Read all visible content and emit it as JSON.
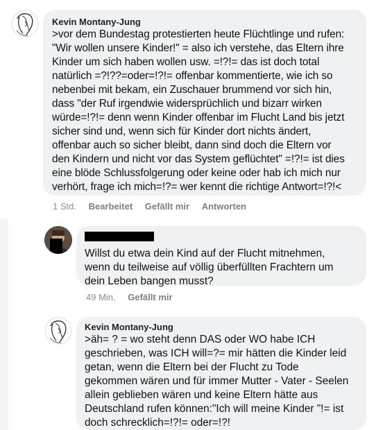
{
  "comments": [
    {
      "author": "Kevin Montany-Jung",
      "text": ">vor dem Bundestag protestierten heute Flüchtlinge und rufen:\n\"Wir wollen unsere Kinder!\" =  also ich verstehe, das Eltern ihre\nKinder um sich haben wollen usw. =!?!= das ist doch total\nnatürlich =?!??=oder=!?!= offenbar kommentierte, wie ich so\nnebenbei mit bekam,  ein Zuschauer  brummend vor sich hin,\ndass \"der Ruf irgendwie widersprüchlich und bizarr wirken\nwürde=!?!= denn wenn Kinder offenbar im Flucht Land bis jetzt\nsicher sind und, wenn  sich für Kinder dort nichts ändert,\noffenbar auch so sicher bleibt, dann sind doch die Eltern vor\nden Kindern und nicht vor das System geflüchtet\" =!?!= ist dies\neine blöde Schlussfolgerung oder keine  oder hab ich mich nur\nverhört, frage ich mich=!?= wer kennt die richtige Antwort=!?!<",
      "time": "1 Std.",
      "actions": [
        "Bearbeitet",
        "Gefällt mir",
        "Antworten"
      ],
      "avatar_icon": "sketch-face-icon"
    },
    {
      "author": "",
      "author_redacted": true,
      "text": "Willst du etwa dein Kind auf der Flucht mitnehmen,\nwenn du teilweise auf völlig überfüllten Frachtern um\ndein Leben bangen musst?",
      "time": "49 Min.",
      "actions": [
        "Gefällt mir"
      ],
      "avatar_icon": "profile-photo-icon"
    },
    {
      "author": "Kevin Montany-Jung",
      "text": ">äh= ? = wo steht denn DAS oder WO habe ICH\ngeschrieben,  was ICH will=?= mir hätten die Kinder leid\ngetan, wenn die Eltern bei der Flucht zu Tode\ngekommen wären und für immer Mutter - Vater - Seelen\nallein geblieben wären und keine Eltern hätte aus\nDeutschland rufen können:\"Ich will meine Kinder \"!= ist\ndoch schrecklich=!?!= oder=!?!",
      "avatar_icon": "sketch-face-icon"
    }
  ],
  "colors": {
    "bubble": "#eff1f3",
    "meta_text": "#8a8d91",
    "body_text": "#111111"
  }
}
